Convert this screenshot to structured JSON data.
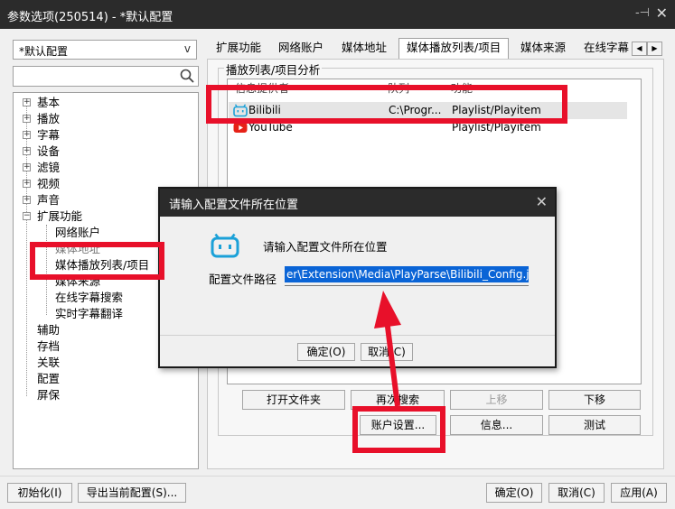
{
  "window": {
    "title": "参数选项(250514) - *默认配置",
    "pin": "-⊣",
    "close": "✕"
  },
  "profile": {
    "selected": "*默认配置",
    "arrow": "v"
  },
  "search": {
    "placeholder": ""
  },
  "tree": {
    "items": [
      {
        "label": "基本",
        "expander": "+"
      },
      {
        "label": "播放",
        "expander": "+"
      },
      {
        "label": "字幕",
        "expander": "+"
      },
      {
        "label": "设备",
        "expander": "+"
      },
      {
        "label": "滤镜",
        "expander": "+"
      },
      {
        "label": "视频",
        "expander": "+"
      },
      {
        "label": "声音",
        "expander": "+"
      },
      {
        "label": "扩展功能",
        "expander": "−"
      }
    ],
    "children": [
      "网络账户",
      "媒体地址",
      "媒体播放列表/项目",
      "媒体来源",
      "在线字幕搜索",
      "实时字幕翻译"
    ],
    "rest": [
      "辅助",
      "存档",
      "关联",
      "配置",
      "屏保"
    ]
  },
  "tabs": [
    "扩展功能",
    "网络账户",
    "媒体地址",
    "媒体播放列表/项目",
    "媒体来源",
    "在线字幕"
  ],
  "tab_scroll": {
    "left": "◀",
    "right": "▶"
  },
  "group": {
    "title": "播放列表/项目分析"
  },
  "list": {
    "headers": [
      "信息提供者",
      "队列",
      "功能"
    ],
    "rows": [
      {
        "name": "Bilibili",
        "path": "C:\\Progr...",
        "func": "Playlist/Playitem",
        "icon": "bilibili-icon"
      },
      {
        "name": "YouTube",
        "path": "",
        "func": "Playlist/Playitem",
        "icon": "youtube-icon"
      }
    ]
  },
  "buttons": {
    "open_folder": "打开文件夹",
    "research": "再次搜索",
    "up": "上移",
    "down": "下移",
    "account": "账户设置...",
    "info": "信息...",
    "test": "测试"
  },
  "footer": {
    "init": "初始化(I)",
    "export": "导出当前配置(S)...",
    "ok": "确定(O)",
    "cancel": "取消(C)",
    "apply": "应用(A)"
  },
  "modal": {
    "title": "请输入配置文件所在位置",
    "close": "✕",
    "message": "请输入配置文件所在位置",
    "path_label": "配置文件路径",
    "path_value": "er\\Extension\\Media\\PlayParse\\Bilibili_Config.json",
    "ok": "确定(O)",
    "cancel": "取消(C)"
  },
  "colors": {
    "annotation": "#e8102a",
    "selection": "#0a64d6",
    "bilibili": "#1ba1d8",
    "youtube": "#e62117"
  }
}
